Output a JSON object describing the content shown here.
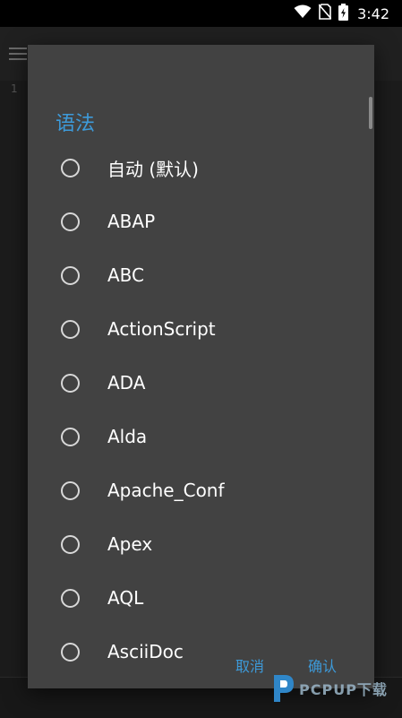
{
  "status_bar": {
    "time": "3:42",
    "icons": [
      "wifi-icon",
      "no-sim-icon",
      "battery-charging-icon"
    ]
  },
  "dialog": {
    "title": "语法",
    "options": [
      {
        "label": "自动 (默认)",
        "selected": false
      },
      {
        "label": "ABAP",
        "selected": false
      },
      {
        "label": "ABC",
        "selected": false
      },
      {
        "label": "ActionScript",
        "selected": false
      },
      {
        "label": "ADA",
        "selected": false
      },
      {
        "label": "Alda",
        "selected": false
      },
      {
        "label": "Apache_Conf",
        "selected": false
      },
      {
        "label": "Apex",
        "selected": false
      },
      {
        "label": "AQL",
        "selected": false
      },
      {
        "label": "AsciiDoc",
        "selected": false
      }
    ],
    "cancel_label": "取消",
    "ok_label": "确认"
  },
  "background": {
    "gutter_number": "1"
  },
  "watermark": {
    "text": "PCPUP下载"
  },
  "colors": {
    "accent": "#3d9ad9",
    "dialog_bg": "#424242",
    "text": "#ffffff"
  }
}
